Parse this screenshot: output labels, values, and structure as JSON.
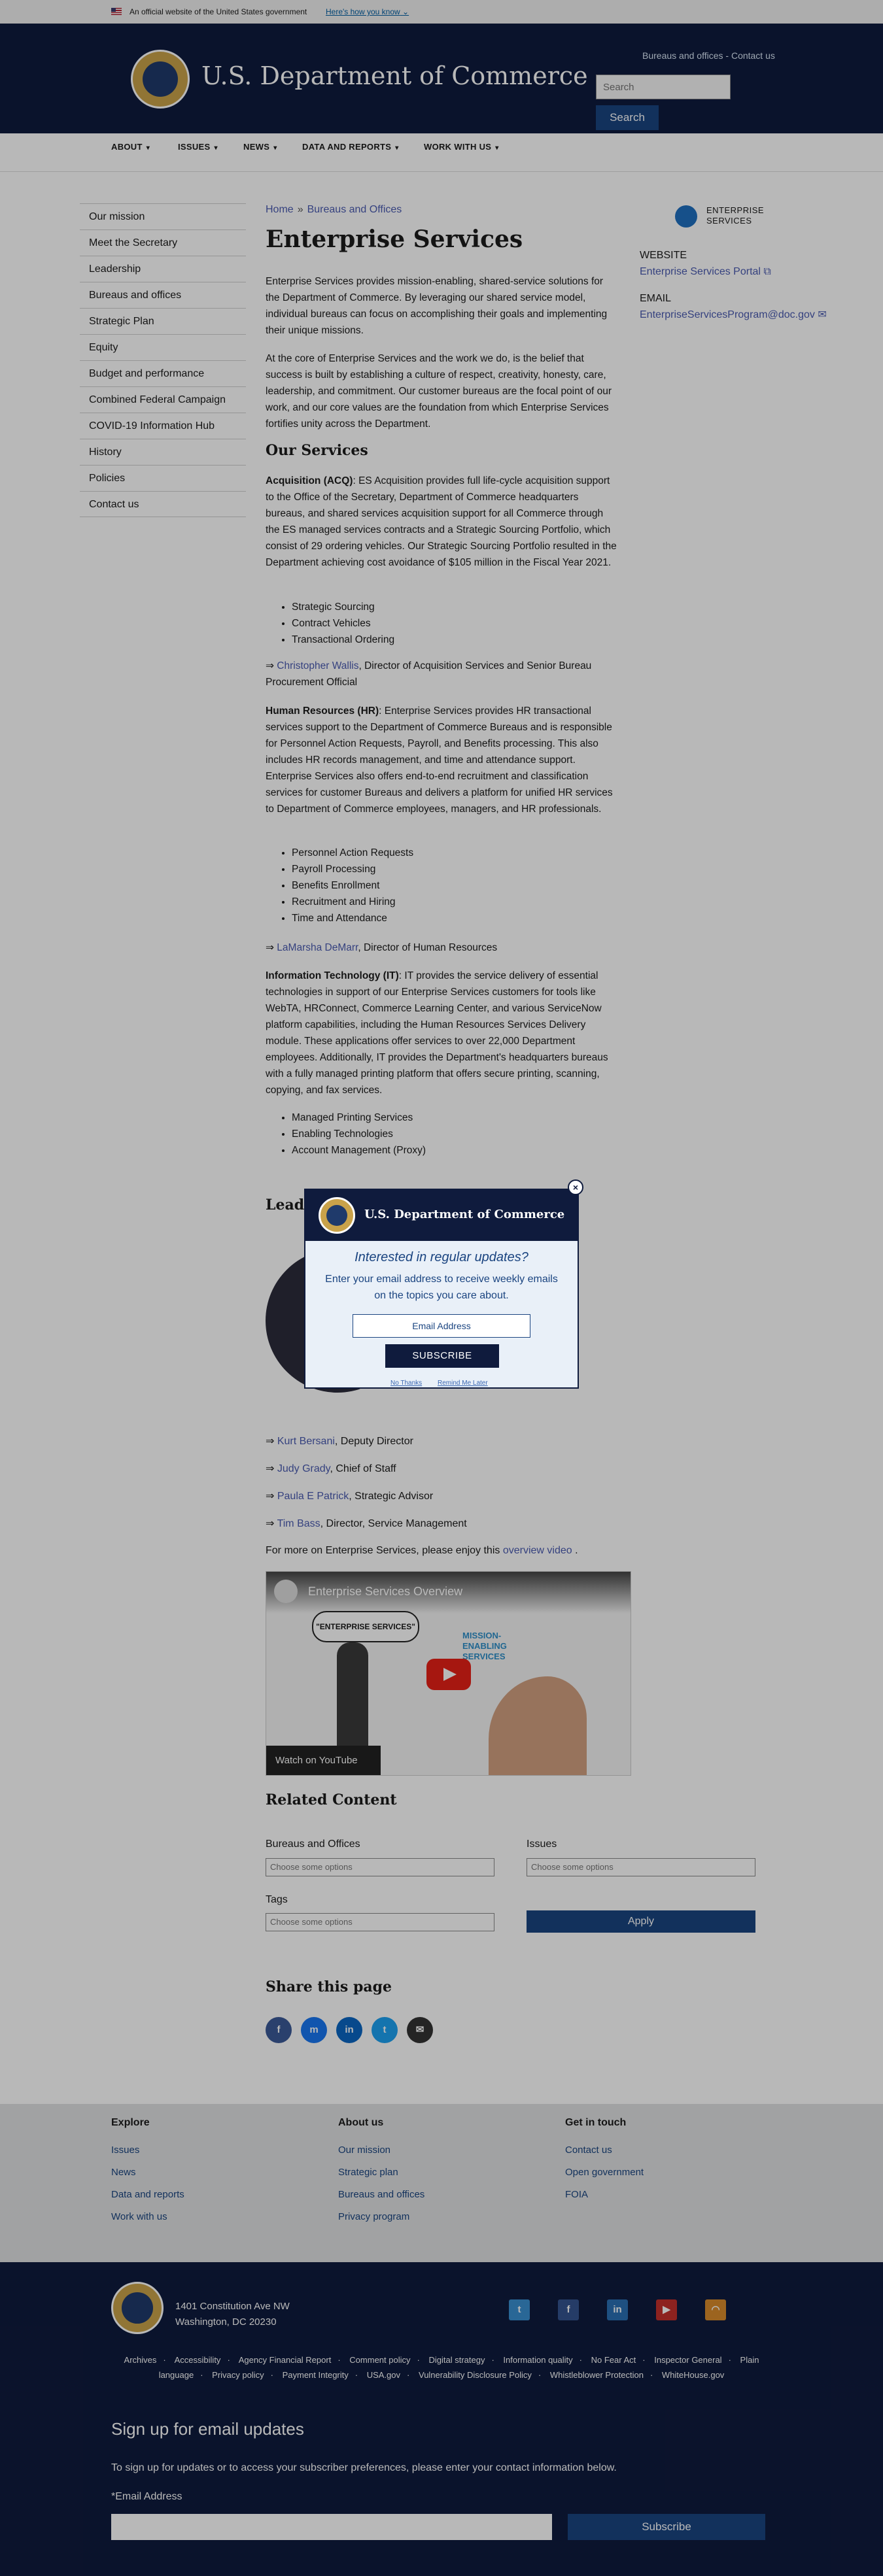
{
  "banner": {
    "text": "An official website of the United States government",
    "link": "Here's how you know"
  },
  "header": {
    "site_title": "U.S. Department of Commerce",
    "top_links": {
      "bureaus": "Bureaus and offices",
      "sep": " - ",
      "contact": "Contact us"
    },
    "search": {
      "placeholder": "Search",
      "button": "Search"
    }
  },
  "mainnav": {
    "items": [
      "ABOUT",
      "ISSUES",
      "NEWS",
      "DATA AND REPORTS",
      "WORK WITH US"
    ]
  },
  "sidebar": {
    "items": [
      "Our mission",
      "Meet the Secretary",
      "Leadership",
      "Bureaus and offices",
      "Strategic Plan",
      "Equity",
      "Budget and performance",
      "Combined Federal Campaign",
      "COVID-19 Information Hub",
      "History",
      "Policies",
      "Contact us"
    ]
  },
  "breadcrumb": {
    "home": "Home",
    "current": "Bureaus and Offices"
  },
  "page": {
    "title": "Enterprise Services",
    "intro1": "Enterprise Services provides mission-enabling, shared-service solutions for the Department of Commerce. By leveraging our shared service model, individual bureaus can focus on accomplishing their goals and implementing their unique missions.",
    "intro2": "At the core of Enterprise Services and the work we do, is the belief that success is built by establishing a culture of respect, creativity, honesty, care, leadership, and commitment. Our customer bureaus are the focal point of our work, and our core values are the foundation from which Enterprise Services fortifies unity across the Department.",
    "our_services": "Our Services",
    "acq": {
      "label": "Acquisition (ACQ)",
      "text": ": ES Acquisition provides full life-cycle acquisition support to the Office of the Secretary, Department of Commerce headquarters bureaus, and shared services acquisition support for all Commerce through the ES managed services contracts and a Strategic Sourcing Portfolio, which consist of 29 ordering vehicles. Our Strategic Sourcing Portfolio resulted in the Department achieving cost avoidance of $105 million in the Fiscal Year 2021.",
      "items": [
        "Strategic Sourcing",
        "Contract Vehicles",
        "Transactional Ordering"
      ],
      "contact_arrow": "⇒ ",
      "contact_name": "Christopher Wallis",
      "contact_role": ", Director of Acquisition Services and Senior Bureau Procurement Official"
    },
    "hr": {
      "label": "Human Resources (HR)",
      "text": ": Enterprise Services provides HR transactional services support to the Department of Commerce Bureaus and is responsible for Personnel Action Requests, Payroll, and Benefits processing. This also includes HR records management, and time and attendance support.  Enterprise Services also offers end-to-end recruitment and classification services for customer Bureaus and delivers a platform for unified HR services to Department of Commerce employees, managers, and HR professionals.",
      "items": [
        "Personnel Action Requests",
        "Payroll Processing",
        "Benefits Enrollment",
        "Recruitment and Hiring",
        "Time and Attendance"
      ],
      "contact_arrow": "⇒ ",
      "contact_name": "LaMarsha DeMarr",
      "contact_role": ", Director of Human Resources"
    },
    "it": {
      "label": "Information Technology (IT)",
      "text": ": IT provides the service delivery of essential technologies in support of our Enterprise Services customers for tools like WebTA, HRConnect, Commerce Learning Center, and various ServiceNow platform capabilities, including the Human Resources Services Delivery module.  These applications offer services to over 22,000 Department employees. Additionally, IT provides the Department's headquarters bureaus with a fully managed printing platform that offers secure printing, scanning, copying, and fax services.",
      "items": [
        "Managed Printing Services",
        "Enabling Technologies",
        "Account Management (Proxy)"
      ]
    },
    "leadership_heading": "Leadership",
    "people": [
      {
        "arrow": "⇒ ",
        "name": "Kurt Bersani",
        "role": ", Deputy Director"
      },
      {
        "arrow": "⇒ ",
        "name": "Judy Grady",
        "role": ", Chief of Staff"
      },
      {
        "arrow": "⇒ ",
        "name": "Paula E Patrick",
        "role": ", Strategic Advisor"
      },
      {
        "arrow": "⇒ ",
        "name": "Tim Bass",
        "role": ", Director, Service Management"
      }
    ],
    "more_text": "For more on Enterprise Services, please enjoy this ",
    "more_link": "overview video",
    "more_end": " .",
    "video": {
      "title": "Enterprise Services Overview",
      "bubble": "\"ENTERPRISE SERVICES\"",
      "mesa1": "MISSION-",
      "mesa2": "ENABLING",
      "mesa3": "SERVICES",
      "watch": "Watch on YouTube"
    }
  },
  "related": {
    "heading": "Related Content",
    "bureaus_label": "Bureaus and Offices",
    "issues_label": "Issues",
    "tags_label": "Tags",
    "placeholder": "Choose some options",
    "apply": "Apply"
  },
  "share": {
    "heading": "Share this page",
    "icons": [
      "f",
      "m",
      "in",
      "t",
      "✉"
    ]
  },
  "aside": {
    "logo_text": "ENTERPRISE SERVICES",
    "website_label": "WEBSITE",
    "website_link": "Enterprise Services Portal",
    "email_label": "EMAIL",
    "email_link": "EnterpriseServicesProgram@doc.gov"
  },
  "footer": {
    "explore": {
      "title": "Explore",
      "links": [
        "Issues",
        "News",
        "Data and reports",
        "Work with us"
      ]
    },
    "about": {
      "title": "About us",
      "links": [
        "Our mission",
        "Strategic plan",
        "Bureaus and offices",
        "Privacy program"
      ]
    },
    "contact": {
      "title": "Get in touch",
      "links": [
        "Contact us",
        "Open government",
        "FOIA"
      ]
    },
    "address_line1": "1401 Constitution Ave NW",
    "address_line2": "Washington, DC 20230",
    "small_links": [
      "Archives",
      "Accessibility",
      "Agency Financial Report",
      "Comment policy",
      "Digital strategy",
      "Information quality",
      "No Fear Act",
      "Inspector General",
      "Plain language",
      "Privacy policy",
      "Payment Integrity",
      "USA.gov",
      "Vulnerability Disclosure Policy",
      "Whistleblower Protection",
      "WhiteHouse.gov"
    ],
    "signup_heading": "Sign up for email updates",
    "signup_text": "To sign up for updates or to access your subscriber preferences, please enter your contact information below.",
    "email_label": "*Email Address",
    "subscribe": "Subscribe"
  },
  "modal": {
    "title": "U.S. Department of Commerce",
    "heading": "Interested in regular updates?",
    "text": "Enter your email address to receive weekly emails on the topics you care about.",
    "email_placeholder": "Email Address",
    "subscribe": "SUBSCRIBE",
    "no_thanks": "No Thanks",
    "remind_later": "Remind Me Later",
    "close": "×"
  },
  "colors": {
    "navy": "#0f1b3d",
    "link": "#4a5bb0",
    "button": "#1a4480"
  }
}
